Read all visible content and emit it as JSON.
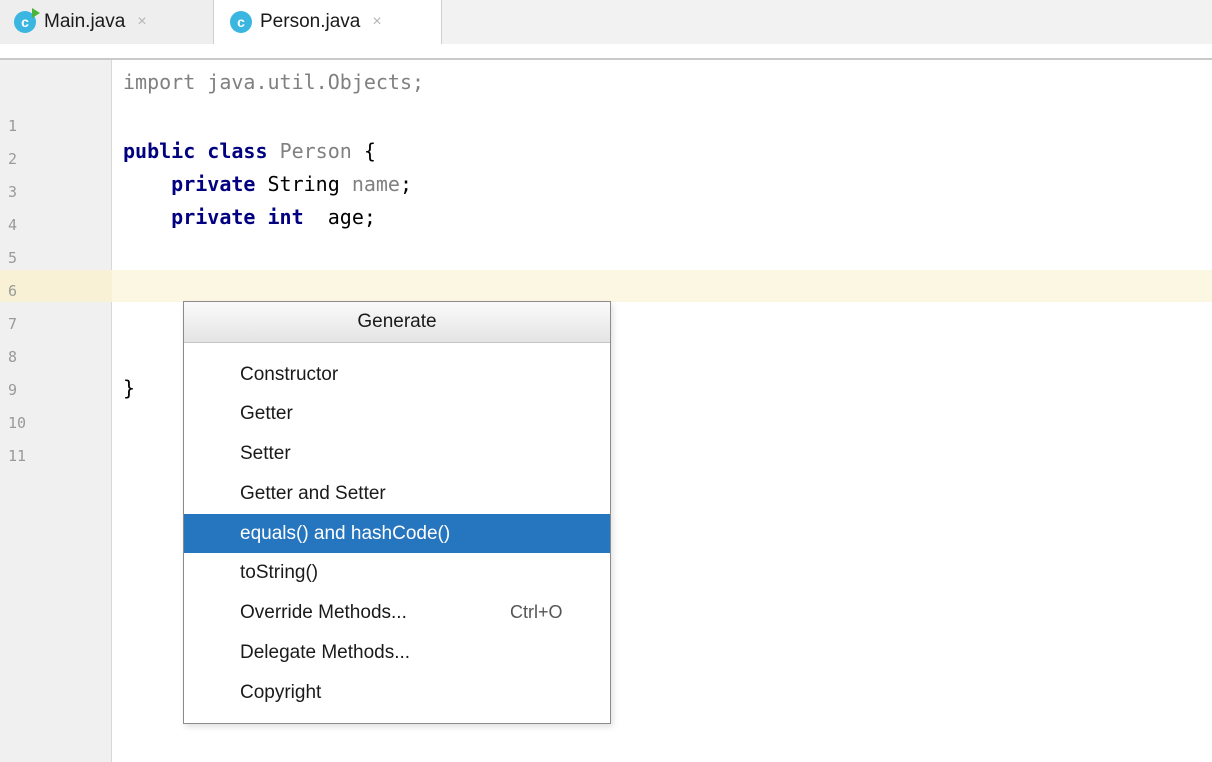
{
  "tabs": [
    {
      "label": "Main.java",
      "icon": "java-runnable-class-icon",
      "active": false
    },
    {
      "label": "Person.java",
      "icon": "java-class-icon",
      "active": true
    }
  ],
  "tab_close_glyph": "×",
  "class_icon_letter": "c",
  "editor": {
    "line_numbers": [
      "1",
      "2",
      "3",
      "4",
      "5",
      "6",
      "7",
      "8",
      "9",
      "10",
      "11"
    ],
    "code": {
      "l1_import": "import",
      "l1_rest": " java.util.Objects;",
      "l3_public": "public",
      "l3_class": "class",
      "l3_name": "Person",
      "l3_brace": "{",
      "l4_private": "private",
      "l4_type": "String",
      "l4_field": "name",
      "l4_semi": ";",
      "l5_private": "private",
      "l5_type": "int",
      "l5_field": "age",
      "l5_semi": ";",
      "l10_brace": "}"
    }
  },
  "generate_popup": {
    "title": "Generate",
    "items": [
      {
        "label": "Constructor"
      },
      {
        "label": "Getter"
      },
      {
        "label": "Setter"
      },
      {
        "label": "Getter and Setter"
      },
      {
        "label": "equals() and hashCode()",
        "selected": true
      },
      {
        "label": "toString()"
      },
      {
        "label": "Override Methods...",
        "shortcut": "Ctrl+O"
      },
      {
        "label": "Delegate Methods..."
      },
      {
        "label": "Copyright"
      }
    ]
  },
  "colors": {
    "keyword": "#000080",
    "selection": "#2675bf",
    "caret_line": "#fcf7e3",
    "class_icon": "#3ab6e0",
    "run_badge": "#4ab537"
  }
}
